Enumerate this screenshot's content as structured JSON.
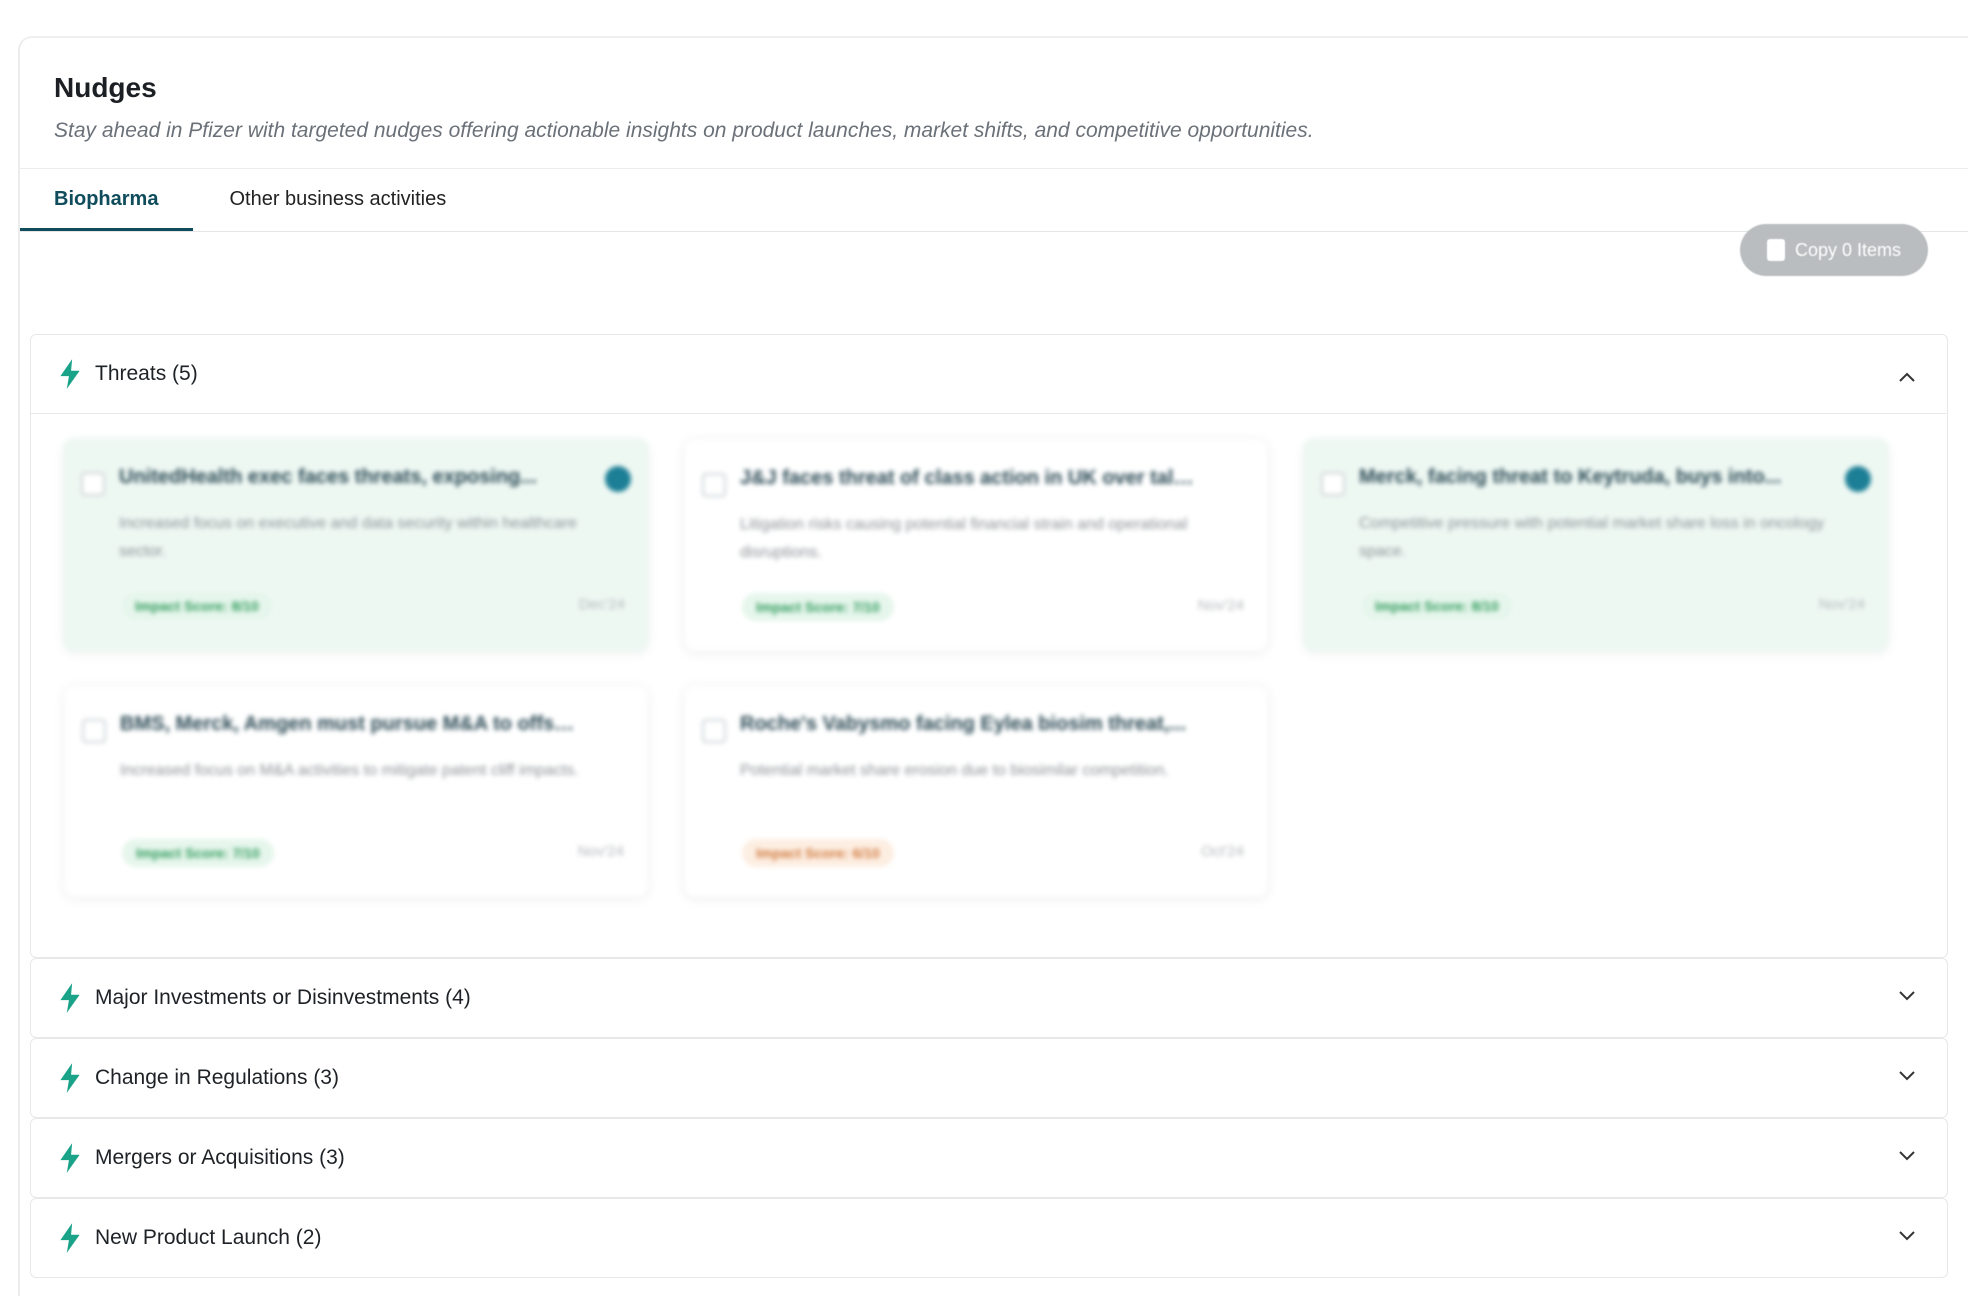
{
  "header": {
    "title": "Nudges",
    "subtitle": "Stay ahead in Pfizer with targeted nudges offering actionable insights on product launches, market shifts, and competitive opportunities."
  },
  "tabs": [
    {
      "label": "Biopharma",
      "active": true
    },
    {
      "label": "Other business activities",
      "active": false
    }
  ],
  "toolbar": {
    "copy_label": "Copy 0 Items"
  },
  "colors": {
    "accent": "#0f4c5c",
    "bolt": "#1aa389",
    "selected_card": "#eef8f3",
    "copy_button": "#b9bdbf"
  },
  "sections": [
    {
      "title": "Threats (5)",
      "expanded": true,
      "cards": [
        {
          "title": "UnitedHealth exec faces threats, exposing...",
          "description": "Increased focus on executive and data security within healthcare sector.",
          "impact": "Impact Score: 8/10",
          "date": "Dec'24",
          "selected": true,
          "badge": "green"
        },
        {
          "title": "J&J faces threat of class action in UK over talc...",
          "description": "Litigation risks causing potential financial strain and operational disruptions.",
          "impact": "Impact Score: 7/10",
          "date": "Nov'24",
          "selected": false,
          "badge": "green"
        },
        {
          "title": "Merck, facing threat to Keytruda, buys into...",
          "description": "Competitive pressure with potential market share loss in oncology space.",
          "impact": "Impact Score: 8/10",
          "date": "Nov'24",
          "selected": true,
          "badge": "green"
        },
        {
          "title": "BMS, Merck, Amgen must pursue M&A to offse...",
          "description": "Increased focus on M&A activities to mitigate patent cliff impacts.",
          "impact": "Impact Score: 7/10",
          "date": "Nov'24",
          "selected": false,
          "badge": "green"
        },
        {
          "title": "Roche's Vabysmo facing Eylea biosim threat,...",
          "description": "Potential market share erosion due to biosimilar competition.",
          "impact": "Impact Score: 6/10",
          "date": "Oct'24",
          "selected": false,
          "badge": "orange"
        }
      ]
    },
    {
      "title": "Major Investments or Disinvestments (4)",
      "expanded": false
    },
    {
      "title": "Change in Regulations (3)",
      "expanded": false
    },
    {
      "title": "Mergers or Acquisitions (3)",
      "expanded": false
    },
    {
      "title": "New Product Launch (2)",
      "expanded": false
    }
  ],
  "icons": {
    "section": "bolt-icon",
    "expand": "chevron-down-icon",
    "collapse": "chevron-up-icon",
    "selected": "check-circle-icon",
    "copy": "copy-icon"
  }
}
